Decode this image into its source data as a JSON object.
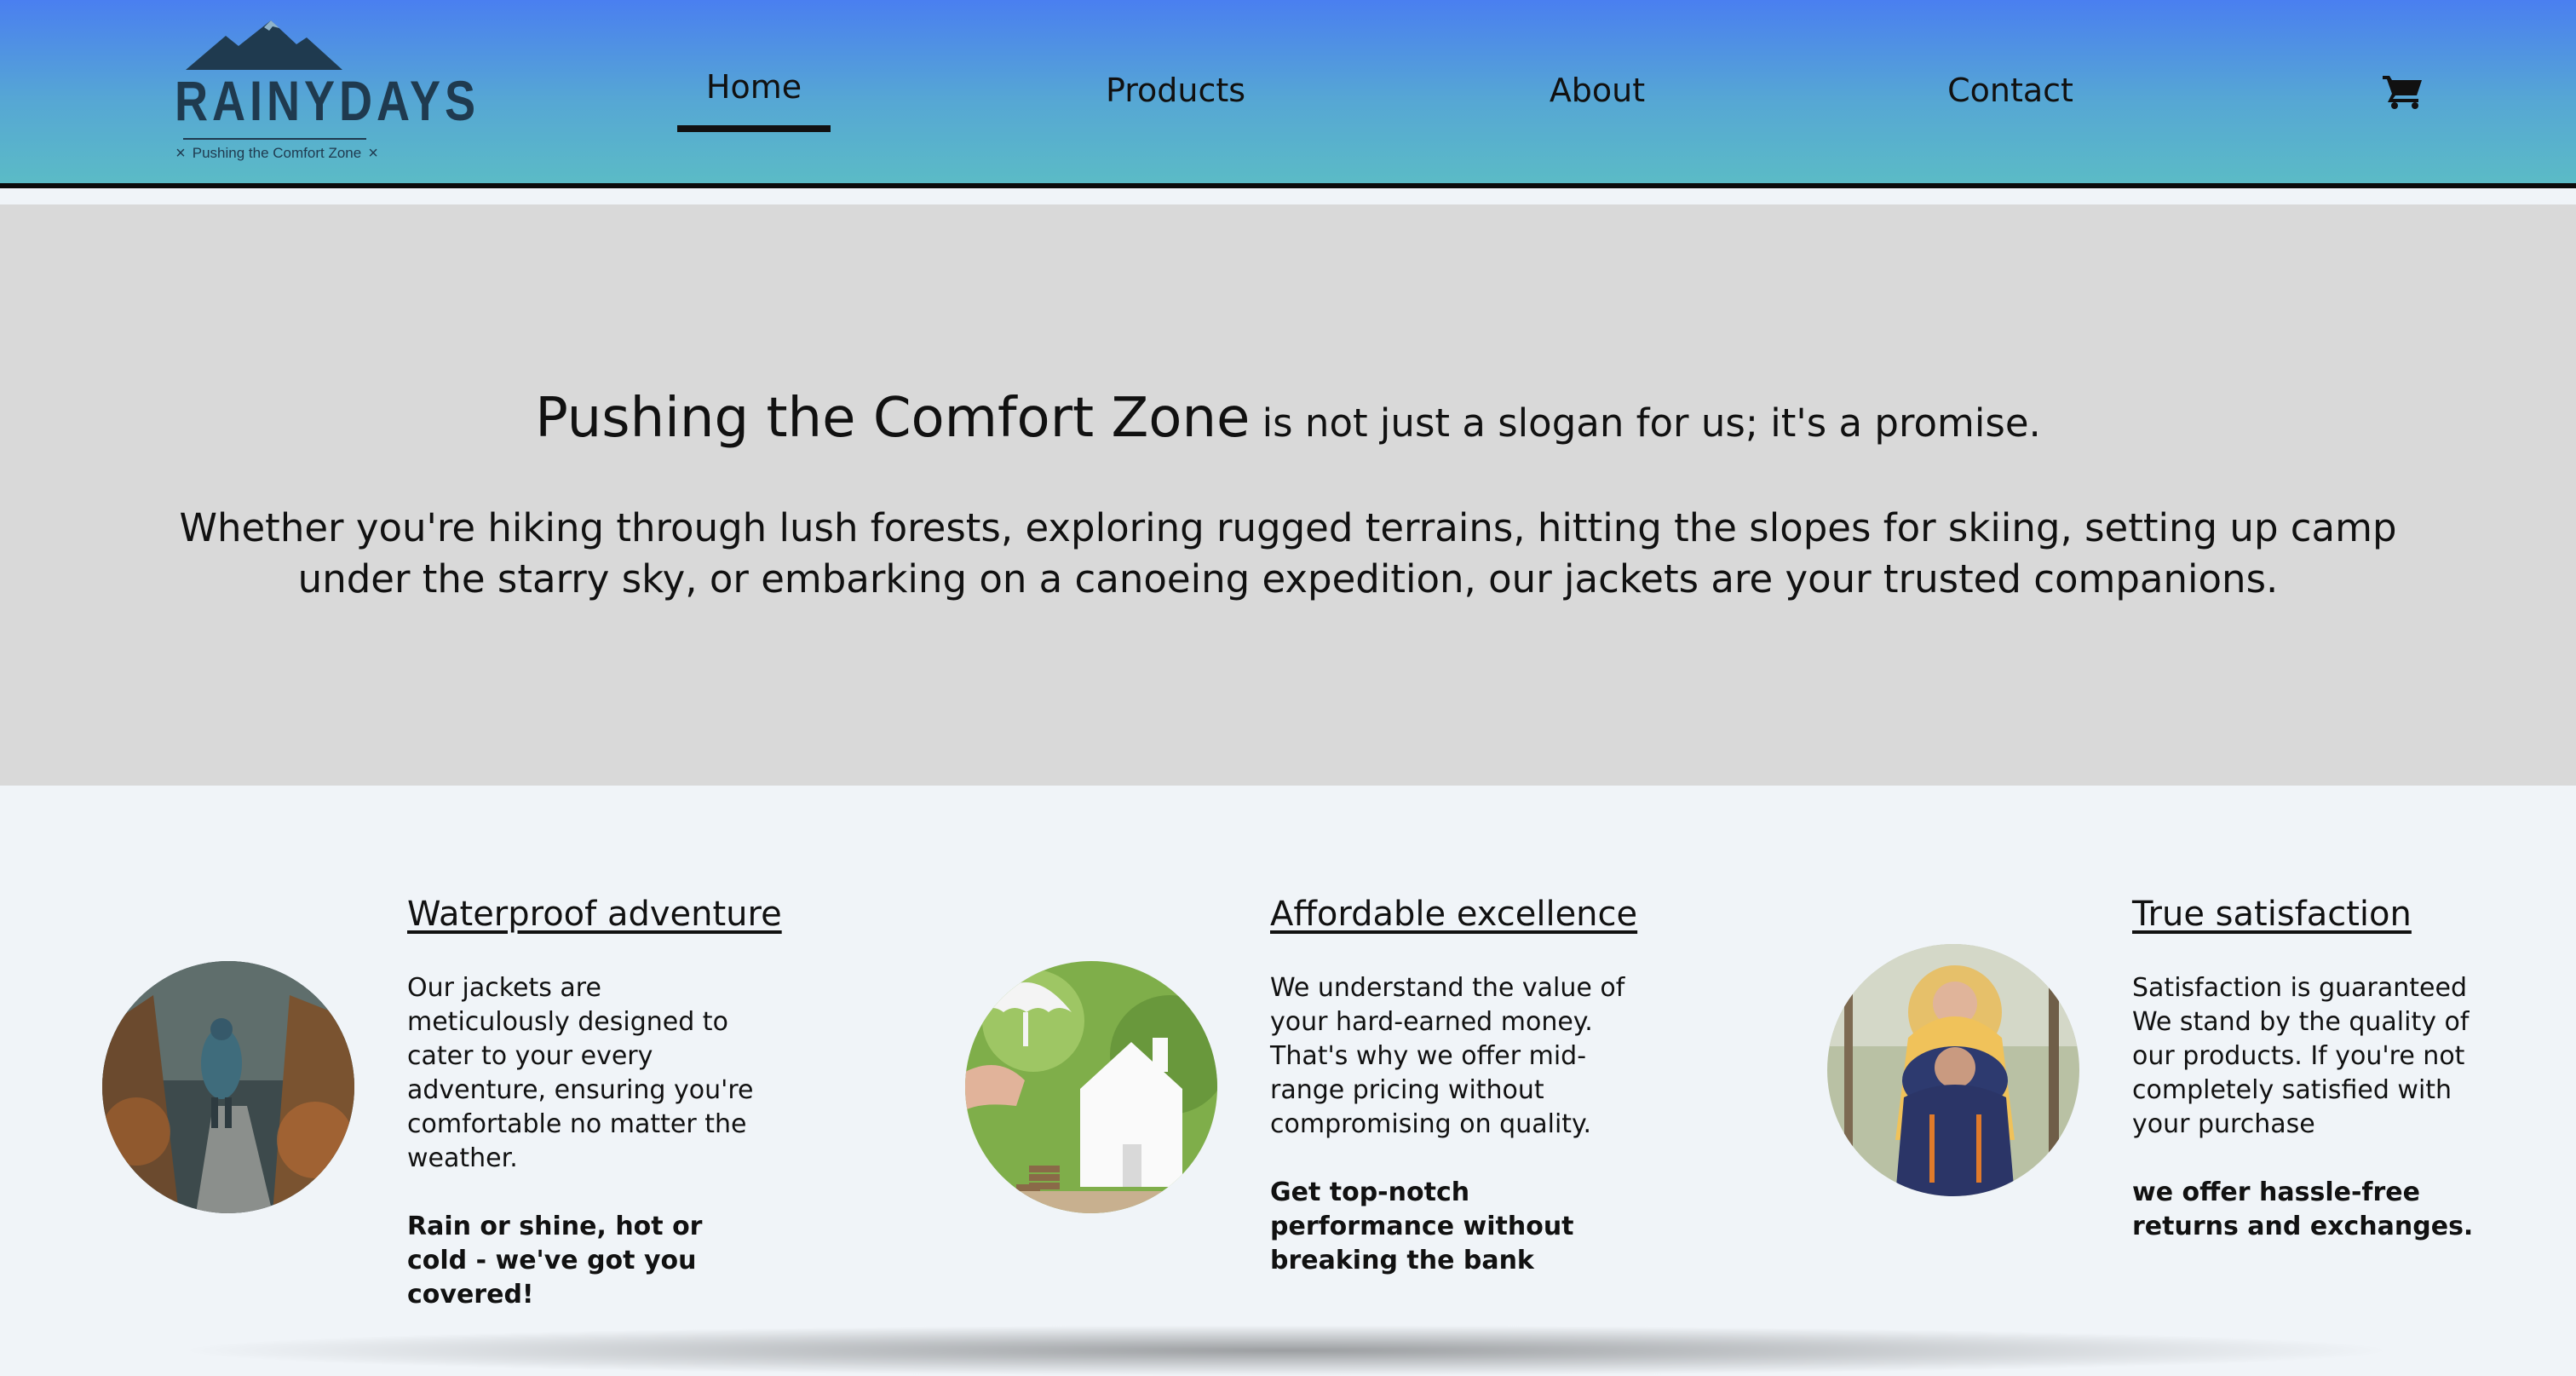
{
  "header": {
    "brand": "RAINYDAYS",
    "tagline": "Pushing the Comfort Zone",
    "nav": [
      {
        "label": "Home",
        "active": true
      },
      {
        "label": "Products",
        "active": false
      },
      {
        "label": "About",
        "active": false
      },
      {
        "label": "Contact",
        "active": false
      }
    ],
    "cart_icon": "shopping-cart-icon"
  },
  "hero": {
    "highlight": "Pushing the Comfort Zone",
    "line1_rest": " is not just a slogan for us; it's a promise.",
    "line2": "Whether you're hiking through lush forests, exploring rugged terrains, hitting the slopes for skiing, setting up camp under the starry sky, or embarking on a canoeing expedition, our jackets are your trusted companions."
  },
  "features": [
    {
      "title": "Waterproof adventure",
      "body": "Our jackets are meticulously designed to cater to your every adventure, ensuring you're comfortable no matter the weather.",
      "strong": "Rain or shine, hot or cold - we've got you covered!",
      "image": "hiker-in-forest"
    },
    {
      "title": "Affordable excellence",
      "body": "We understand the value of your hard-earned money. That's why we offer mid-range pricing without compromising on quality.",
      "strong": "Get top-notch performance without breaking the bank",
      "image": "house-umbrella-coins"
    },
    {
      "title": "True satisfaction",
      "body": "Satisfaction is guaranteed We stand by the quality of our products. If you're not completely satisfied with your purchase",
      "strong": "we offer hassle-free returns and exchanges.",
      "image": "happy-couple-jackets"
    }
  ],
  "colors": {
    "header_top": "#4a7ff0",
    "header_bottom": "#5bbbc6",
    "hero_bg": "#d9d9d9",
    "page_bg": "#f0f4f8",
    "logo": "#1f3a4f"
  }
}
